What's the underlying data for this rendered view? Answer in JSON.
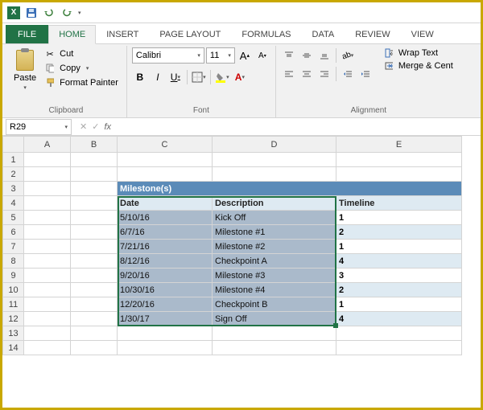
{
  "qat": {
    "save": "save-icon",
    "undo": "undo-icon",
    "redo": "redo-icon"
  },
  "tabs": {
    "file": "FILE",
    "home": "HOME",
    "insert": "INSERT",
    "pagelayout": "PAGE LAYOUT",
    "formulas": "FORMULAS",
    "data": "DATA",
    "review": "REVIEW",
    "view": "VIEW",
    "active": "home"
  },
  "ribbon": {
    "clipboard": {
      "paste": "Paste",
      "cut": "Cut",
      "copy": "Copy",
      "fmtpainter": "Format Painter",
      "label": "Clipboard"
    },
    "font": {
      "name": "Calibri",
      "size": "11",
      "bold": "B",
      "italic": "I",
      "underline": "U",
      "label": "Font"
    },
    "alignment": {
      "wrap": "Wrap Text",
      "merge": "Merge & Cent",
      "label": "Alignment"
    }
  },
  "namebox": "R29",
  "fx": "",
  "cols": [
    "A",
    "B",
    "C",
    "D",
    "E"
  ],
  "table": {
    "title": "Milestone(s)",
    "headers": {
      "date": "Date",
      "desc": "Description",
      "timeline": "Timeline"
    },
    "rows": [
      {
        "date": "5/10/16",
        "desc": "Kick Off",
        "timeline": "1"
      },
      {
        "date": "6/7/16",
        "desc": "Milestone #1",
        "timeline": "2"
      },
      {
        "date": "7/21/16",
        "desc": "Milestone #2",
        "timeline": "1"
      },
      {
        "date": "8/12/16",
        "desc": "Checkpoint A",
        "timeline": "4"
      },
      {
        "date": "9/20/16",
        "desc": "Milestone #3",
        "timeline": "3"
      },
      {
        "date": "10/30/16",
        "desc": "Milestone #4",
        "timeline": "2"
      },
      {
        "date": "12/20/16",
        "desc": "Checkpoint B",
        "timeline": "1"
      },
      {
        "date": "1/30/17",
        "desc": "Sign Off",
        "timeline": "4"
      }
    ]
  }
}
